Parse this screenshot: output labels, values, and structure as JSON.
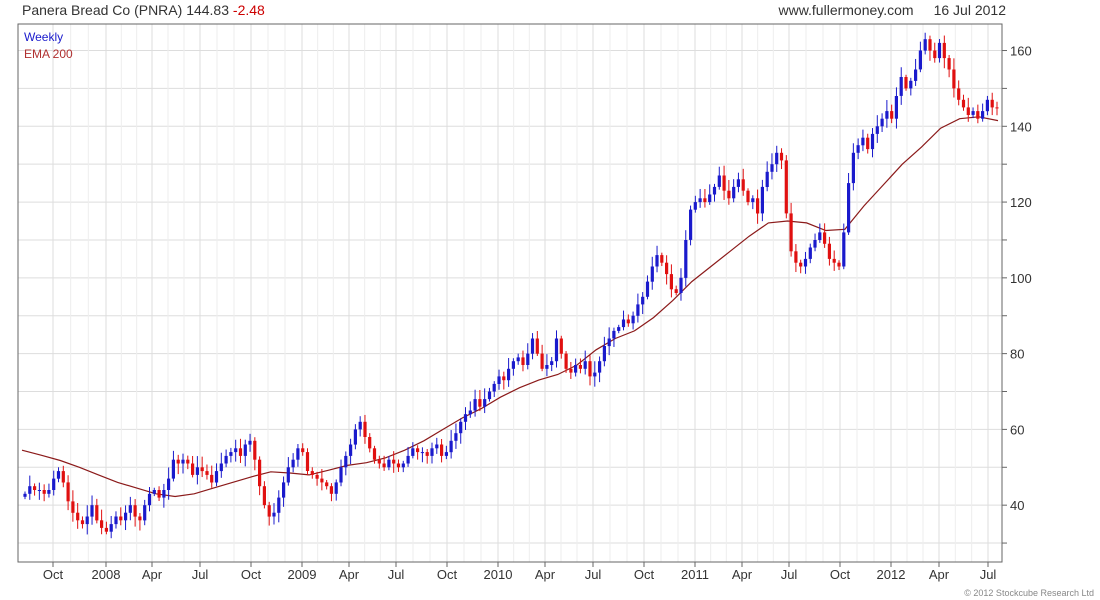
{
  "header": {
    "title_name": "Panera Bread Co (PNRA)",
    "last_price": "144.83",
    "change": "-2.48",
    "site": "www.fullermoney.com",
    "date": "16 Jul 2012"
  },
  "legend": {
    "series1": "Weekly",
    "series2": "EMA 200"
  },
  "footer": {
    "copyright": "© 2012 Stockcube Research Ltd"
  },
  "colors": {
    "up": "#1a1acc",
    "down": "#e01010",
    "ema": "#8b1a1a",
    "grid": "#dddddd"
  },
  "chart_data": {
    "type": "line",
    "title": "Panera Bread Co (PNRA) 144.83 -2.48",
    "x_tick_labels": [
      "Oct",
      "2008",
      "Apr",
      "Jul",
      "Oct",
      "2009",
      "Apr",
      "Jul",
      "Oct",
      "2010",
      "Apr",
      "Jul",
      "Oct",
      "2011",
      "Apr",
      "Jul",
      "Oct",
      "2012",
      "Apr",
      "Jul"
    ],
    "y_ticks": [
      40,
      60,
      80,
      100,
      120,
      140,
      160
    ],
    "ylim": [
      25,
      167
    ],
    "grid": true,
    "legend_position": "top-left",
    "series": [
      {
        "name": "Weekly",
        "style": "candlestick",
        "values": [
          43,
          45,
          44,
          44,
          43,
          44,
          47,
          49,
          46,
          41,
          38,
          36,
          35,
          37,
          40,
          36,
          34,
          33,
          35,
          37,
          36,
          38,
          40,
          37,
          36,
          40,
          43,
          44,
          42,
          44,
          47,
          52,
          51,
          52,
          51,
          48,
          50,
          49,
          48,
          46,
          49,
          51,
          53,
          54,
          55,
          53,
          56,
          57,
          52,
          45,
          40,
          37,
          38,
          42,
          46,
          50,
          52,
          55,
          54,
          49,
          48,
          47,
          46,
          45,
          43,
          46,
          50,
          53,
          56,
          60,
          62,
          58,
          55,
          52,
          51,
          50,
          52,
          51,
          50,
          51,
          53,
          55,
          54,
          54,
          53,
          55,
          56,
          53,
          54,
          57,
          59,
          62,
          64,
          65,
          68,
          66,
          68,
          70,
          72,
          74,
          73,
          76,
          78,
          79,
          77,
          80,
          84,
          80,
          76,
          77,
          78,
          84,
          80,
          76,
          75,
          77,
          76,
          78,
          74,
          75,
          78,
          82,
          84,
          86,
          87,
          89,
          88,
          90,
          93,
          95,
          99,
          103,
          106,
          104,
          101,
          97,
          96,
          100,
          110,
          118,
          120,
          121,
          120,
          122,
          124,
          127,
          123,
          121,
          124,
          126,
          123,
          120,
          121,
          117,
          124,
          128,
          130,
          133,
          131,
          117,
          107,
          104,
          103,
          105,
          108,
          110,
          112,
          109,
          105,
          104,
          103,
          112,
          125,
          133,
          135,
          137,
          134,
          138,
          140,
          142,
          144,
          142,
          148,
          153,
          150,
          152,
          155,
          160,
          163,
          160,
          158,
          162,
          158,
          155,
          150,
          147,
          145,
          143,
          144,
          142,
          144,
          147,
          145,
          144.83
        ]
      },
      {
        "name": "EMA 200",
        "style": "line",
        "values": [
          54.5,
          53.2,
          51.8,
          50,
          48,
          46,
          44.5,
          43,
          42.3,
          43,
          44.5,
          46,
          47.5,
          48.8,
          48.5,
          48,
          49.2,
          50.5,
          51.2,
          52.5,
          54.5,
          57,
          60,
          63,
          65.5,
          68.5,
          71,
          73,
          74.5,
          77,
          81,
          84,
          86,
          89.5,
          94,
          99,
          103,
          107,
          111,
          114.5,
          115,
          114.5,
          112.5,
          112.8,
          119,
          124.5,
          130,
          134.5,
          139.5,
          142,
          142.5,
          141.5
        ]
      }
    ]
  }
}
